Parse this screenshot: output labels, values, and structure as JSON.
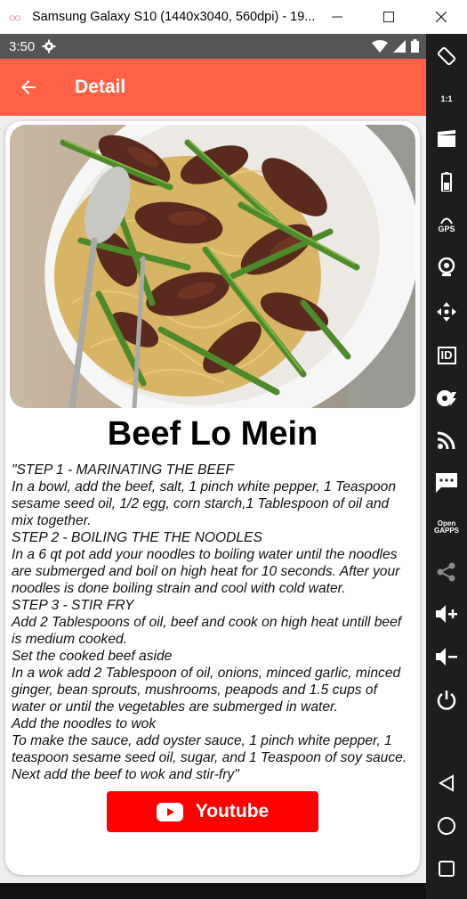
{
  "window": {
    "title": "Samsung Galaxy S10 (1440x3040, 560dpi) - 19...",
    "logo_icon": "genymotion-logo-icon",
    "controls": [
      "minimize-icon",
      "maximize-icon",
      "close-icon"
    ]
  },
  "status_bar": {
    "time": "3:50",
    "icons": [
      "gear-icon",
      "wifi-icon",
      "signal-icon",
      "battery-icon"
    ]
  },
  "app_bar": {
    "title": "Detail",
    "background": "#ff6146",
    "back_icon": "arrow-left-icon"
  },
  "recipe": {
    "title": "Beef Lo Mein",
    "image_alt": "beef-lo-mein-photo",
    "instructions": "\"STEP 1 - MARINATING THE BEEF\nIn a bowl, add the beef, salt, 1 pinch white pepper, 1 Teaspoon sesame seed oil, 1/2 egg, corn starch,1 Tablespoon of oil and mix together.\nSTEP 2 - BOILING THE THE NOODLES\nIn a 6 qt pot add your noodles to boiling water until the noodles are submerged and boil on high heat for 10 seconds. After your noodles is done boiling strain and cool with cold water.\nSTEP 3 - STIR FRY\nAdd 2 Tablespoons of oil, beef and cook on high heat untill beef is medium cooked.\nSet the cooked beef aside\nIn a wok add 2 Tablespoon of oil, onions, minced garlic, minced ginger, bean sprouts, mushrooms, peapods and 1.5 cups of water or until the vegetables are submerged in water.\nAdd the noodles to wok\nTo make the sauce, add oyster sauce, 1 pinch white pepper, 1 teaspoon sesame seed oil, sugar, and 1 Teaspoon of soy sauce. Next add the beef to wok and stir-fry\"",
    "youtube_label": "Youtube",
    "youtube_color": "#ff0000"
  },
  "emulator_toolbar": {
    "items": [
      "rotate-icon",
      "pixel-perfect-icon",
      "capture-icon",
      "battery-icon",
      "gps-icon",
      "webcam-icon",
      "move-icon",
      "device-id-icon",
      "disk-io-icon",
      "cast-icon",
      "sms-icon",
      "open-gapps-icon",
      "share-icon",
      "volume-up-icon",
      "volume-down-icon",
      "power-icon",
      "back-nav-icon",
      "home-nav-icon",
      "recents-nav-icon"
    ],
    "one_to_one_label": "1:1",
    "gps_label": "GPS",
    "id_label": "ID",
    "open_gapps_label": "Open\nGAPPS"
  }
}
